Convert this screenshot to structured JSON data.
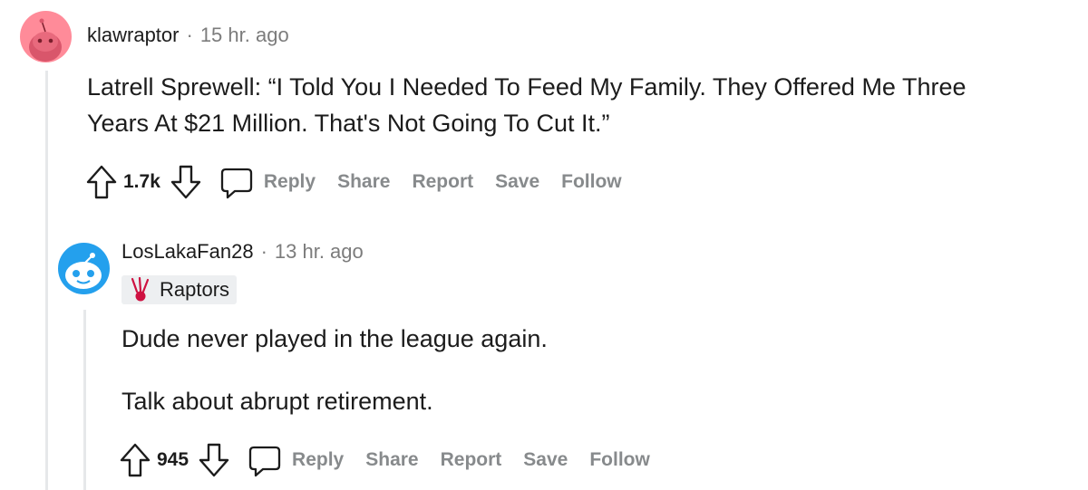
{
  "comments": [
    {
      "username": "klawraptor",
      "separator": "·",
      "time": "15 hr. ago",
      "paragraphs": [
        "Latrell Sprewell: “I Told You I Needed To Feed My Family. They Offered Me Three",
        "Years At $21 Million. That's Not Going To Cut It.”"
      ],
      "score": "1.7k",
      "actions": {
        "reply": "Reply",
        "share": "Share",
        "report": "Report",
        "save": "Save",
        "follow": "Follow"
      },
      "avatar_color": "#ff8b99"
    },
    {
      "username": "LosLakaFan28",
      "separator": "·",
      "time": "13 hr. ago",
      "flair": "Raptors",
      "paragraphs": [
        "Dude never played in the league again.",
        "Talk about abrupt retirement."
      ],
      "score": "945",
      "actions": {
        "reply": "Reply",
        "share": "Share",
        "report": "Report",
        "save": "Save",
        "follow": "Follow"
      },
      "avatar_color": "#24a0ed"
    }
  ],
  "icons": {
    "upvote": "upvote-icon",
    "downvote": "downvote-icon",
    "comment": "comment-icon",
    "flair": "raptors-claw-icon"
  },
  "colors": {
    "muted": "#878a8c",
    "thread_line": "#e6e8ea",
    "flair_bg": "#edeff1"
  }
}
